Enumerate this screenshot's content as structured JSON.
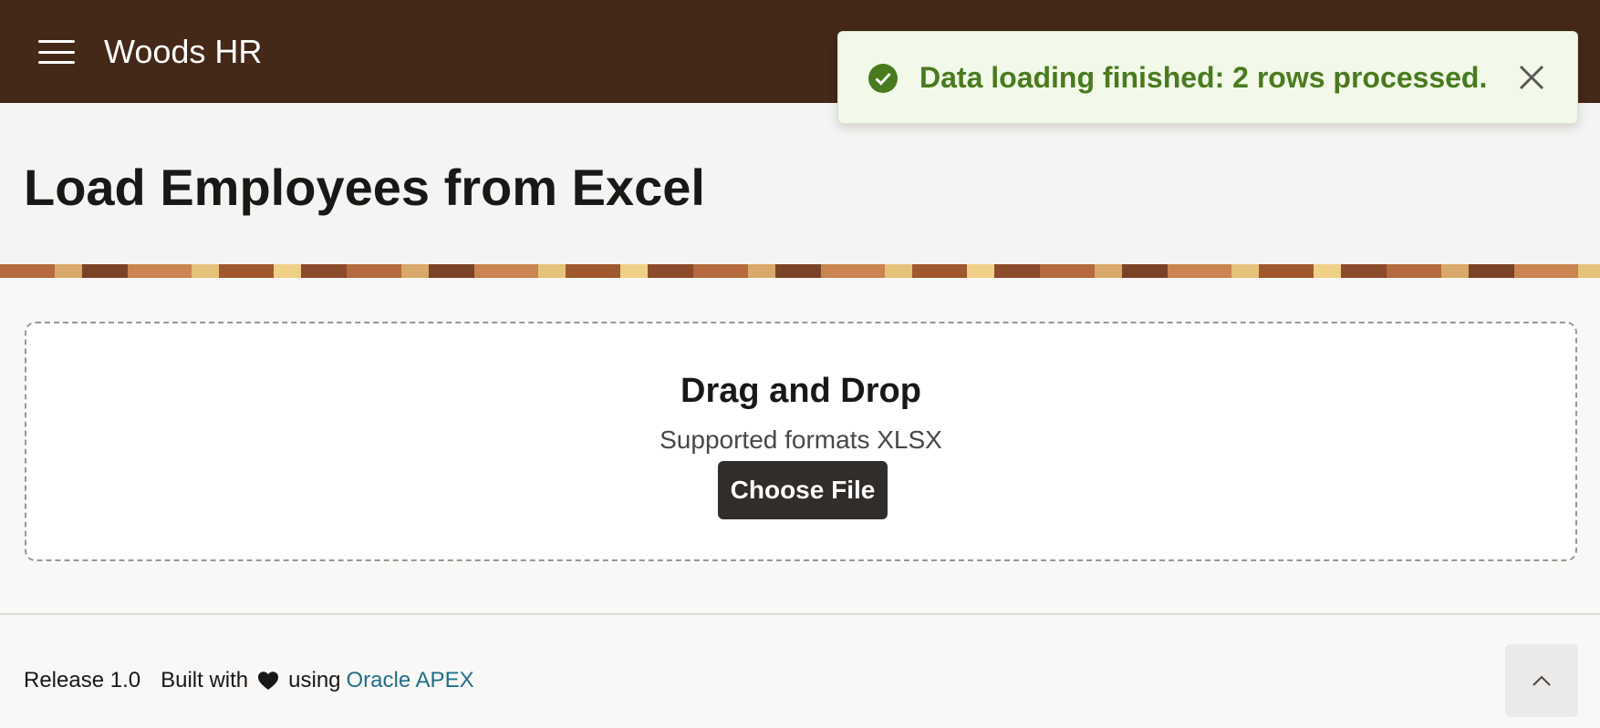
{
  "header": {
    "menu_icon": "hamburger-menu-icon",
    "app_title": "Woods HR"
  },
  "notification": {
    "icon": "check-circle-icon",
    "message": "Data loading finished: 2 rows processed.",
    "close_icon": "close-icon",
    "color": "#4a7a1e"
  },
  "page": {
    "title": "Load Employees from Excel"
  },
  "dropzone": {
    "heading": "Drag and Drop",
    "subtext": "Supported formats XLSX",
    "button_label": "Choose File"
  },
  "footer": {
    "release": "Release 1.0",
    "built_with": "Built with",
    "heart_icon": "heart-icon",
    "using": "using",
    "link_text": "Oracle APEX",
    "scroll_top_icon": "chevron-up-icon"
  },
  "colors": {
    "header_bg": "#442818",
    "button_bg": "#312d2a",
    "link": "#1f6f8b"
  }
}
